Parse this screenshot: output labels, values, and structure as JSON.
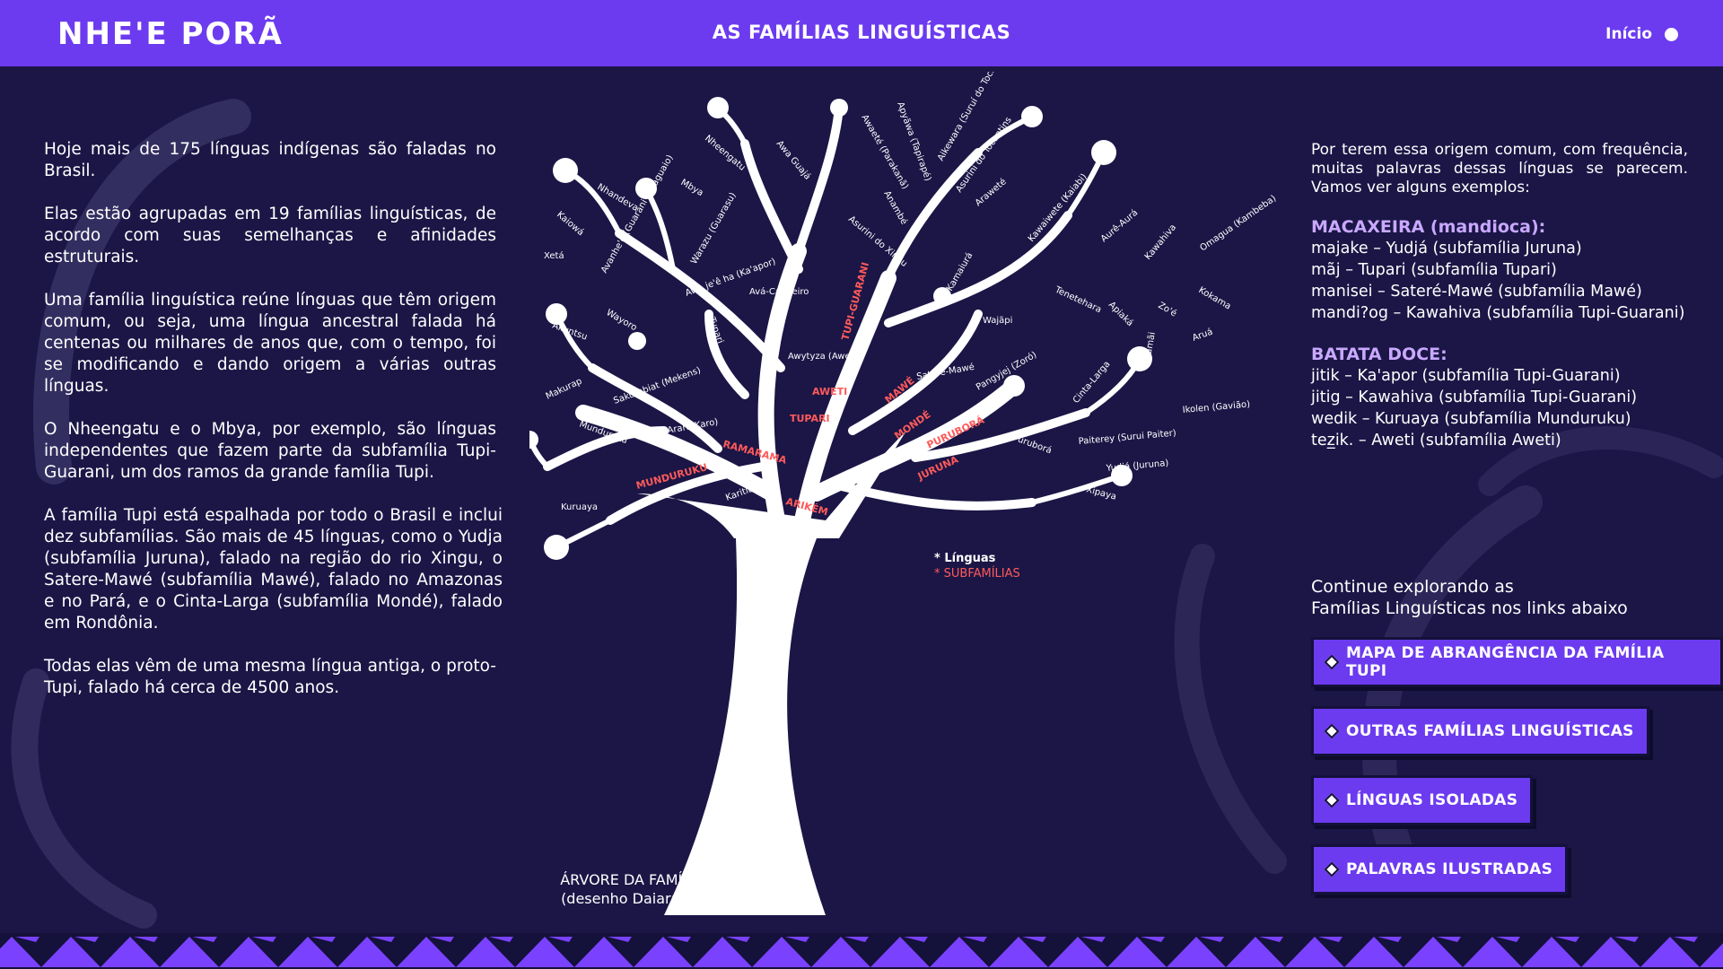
{
  "header": {
    "logo": "NHE'E PORÃ",
    "title": "AS FAMÍLIAS LINGUÍSTICAS",
    "home_label": "Início"
  },
  "left": {
    "paragraphs": [
      "Hoje mais de 175 línguas indígenas são faladas no Brasil.",
      "Elas estão agrupadas em 19 famílias linguísticas, de acordo com suas semelhanças e afinidades estruturais.",
      "Uma família linguística reúne línguas que têm origem comum, ou seja, uma língua ancestral falada há centenas ou milhares de anos que, com o tempo, foi se modificando e dando origem a várias outras línguas.",
      "O Nheengatu e o Mbya, por exemplo, são línguas independentes que fazem parte da subfamília Tupi-Guarani, um dos ramos da grande família Tupi.",
      "A família Tupi está espalhada por todo o Brasil e inclui dez subfamílias. São mais de 45 línguas, como o Yudja (subfamília Juruna), falado na região do rio Xingu, o Satere-Mawé (subfamília Mawé), falado no Amazonas e no Pará, e o Cinta-Larga (subfamília Mondé), falado em Rondônia.",
      "Todas elas vêm de uma mesma língua antiga, o proto-Tupi, falado há cerca de 4500 anos."
    ]
  },
  "tree": {
    "caption_line1": "ÁRVORE DA FAMÍLIA TUPI",
    "caption_line2": "(desenho Daiara Tukano)",
    "legend_languages": "* Línguas",
    "legend_subfamilies": "* SUBFAMÍLIAS",
    "subfamilies": [
      "TUPI-GUARANI",
      "AWETI",
      "TUPARI",
      "RAMARAMA",
      "MUNDURUKU",
      "ARIKÉM",
      "MAWÉ",
      "MONDÉ",
      "PURUBORÁ",
      "JURUNA"
    ],
    "languages": [
      "Nheengatu",
      "Mbya",
      "Nhandeva",
      "Kaiowá",
      "Xetá",
      "Avanhe'ẽ (Guarani paraguaio)",
      "Warazu (Guarasu)",
      "Awa Guajá",
      "Awa je'ê ha (Ka'apor)",
      "Avá-Canoeiro",
      "Awaeté (Parakanã)",
      "Apyãwa (Tapirapé)",
      "Aikewara (Suruí do Tocantins)",
      "Asurini do Tocantins",
      "Anambé",
      "Asurini do Xingu",
      "Araweté",
      "Kawaiwete (Kaiabi)",
      "Kamaiurá",
      "Aurê-Aurá",
      "Kawahiva",
      "Omagua (Kambeba)",
      "Tenetehara",
      "Apiaká",
      "Zo'é",
      "Kokama",
      "Wajãpi",
      "Akuntsu",
      "Wayoro",
      "Tupari",
      "Makurap",
      "Sakurabiat (Mekens)",
      "Awytyza (Aweti)",
      "Munduruku",
      "Karo (Arara-Karo)",
      "Kuruaya",
      "Karitiana",
      "Sateré-Mawé",
      "Pangyjej (Zoró)",
      "Cinta-Larga",
      "Salamãi",
      "Aruá",
      "Ikolen (Gavião)",
      "Paiterey (Surui Paiter)",
      "Puruborá",
      "Yudjá (Juruna)",
      "Xipaya"
    ]
  },
  "right": {
    "intro": "Por terem essa origem comum, com frequência, muitas palavras dessas línguas se parecem. Vamos ver alguns exemplos:",
    "examples": [
      {
        "heading": "MACAXEIRA (mandioca):",
        "lines": [
          "majake – Yudjá (subfamília Juruna)",
          "mãj – Tupari (subfamília Tupari)",
          "manisei – Sateré-Mawé (subfamília  Mawé)",
          "mandi?og –  Kawahiva (subfamília Tupi-Guarani)"
        ]
      },
      {
        "heading": "BATATA DOCE:",
        "lines": [
          "jitik –  Ka'apor (subfamília Tupi-Guarani)",
          "jitig –  Kawahiva (subfamília Tupi-Guarani)",
          "wedik –  Kuruaya (subfamília  Munduruku)",
          "tez̲ik. – Aweti (subfamília Aweti)"
        ]
      }
    ],
    "continue_line1": "Continue explorando as",
    "continue_line2": "Famílias Linguísticas nos links abaixo",
    "links": [
      "MAPA DE ABRANGÊNCIA DA FAMÍLIA TUPI",
      "OUTRAS FAMÍLIAS LINGUÍSTICAS",
      "LÍNGUAS ISOLADAS",
      "PALAVRAS ILUSTRADAS"
    ]
  },
  "colors": {
    "background": "#1b1646",
    "header": "#6c3bf0",
    "button": "#6c3bf0",
    "example_heading": "#c9a8ff",
    "subfamily_label": "#ff5a5a"
  }
}
